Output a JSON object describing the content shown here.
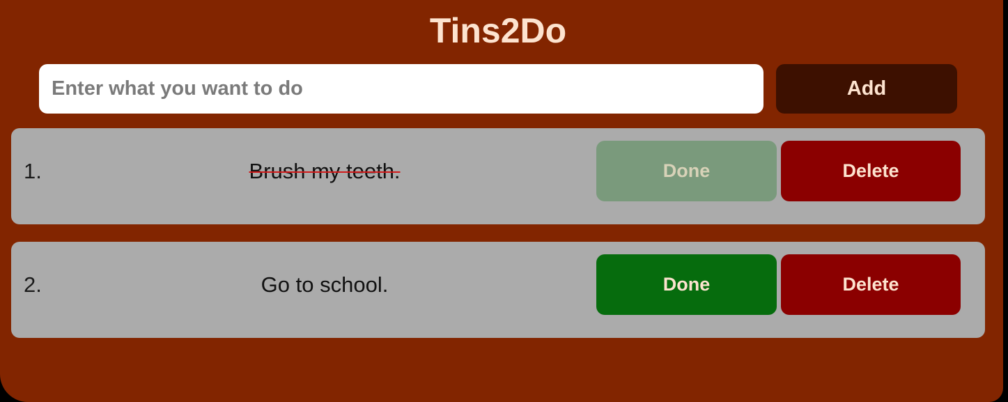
{
  "app": {
    "title": "Tins2Do"
  },
  "input": {
    "placeholder": "Enter what you want to do",
    "value": ""
  },
  "add_button": {
    "label": "Add"
  },
  "todos": [
    {
      "index": "1.",
      "text": "Brush my teeth.",
      "completed": true,
      "done_label": "Done",
      "delete_label": "Delete"
    },
    {
      "index": "2.",
      "text": "Go to school.",
      "completed": false,
      "done_label": "Done",
      "delete_label": "Delete"
    }
  ],
  "colors": {
    "background": "#822500",
    "title": "#fde3cf",
    "add_button": "#3d1000",
    "item_background": "#ababab",
    "done_active": "#066c0d",
    "done_completed": "#7a9a7c",
    "delete": "#8b0000",
    "strike": "#d11a1a"
  }
}
